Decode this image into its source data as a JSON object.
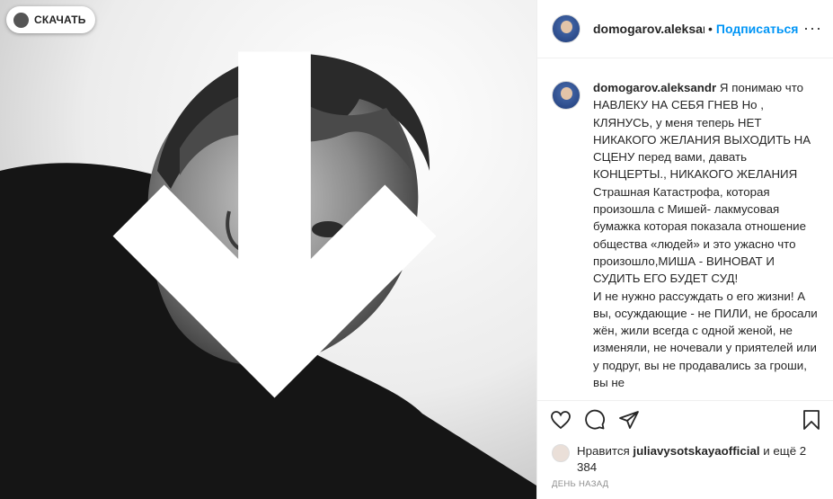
{
  "download_button": {
    "label": "СКАЧАТЬ"
  },
  "header": {
    "username": "domogarov.aleksandr",
    "separator": "•",
    "follow_label": "Подписаться",
    "more_label": "···"
  },
  "caption": {
    "username": "domogarov.aleksandr",
    "text": " Я понимаю что НАВЛЕКУ НА СЕБЯ ГНЕВ Но , КЛЯНУСЬ, у меня теперь НЕТ НИКАКОГО ЖЕЛАНИЯ ВЫХОДИТЬ НА СЦЕНУ перед вами, давать КОНЦЕРТЫ., НИКАКОГО ЖЕЛАНИЯ Страшная Катастрофа, которая произошла с Мишей- лакмусовая бумажка которая показала отношение общества «людей» и это ужасно что произошло,МИША - ВИНОВАТ И СУДИТЬ ЕГО БУДЕТ СУД!\nИ не нужно рассуждать о его жизни! А вы, осуждающие - не ПИЛИ, не бросали жён, жили всегда с одной женой, не изменяли, не ночевали у приятелей или у подруг, вы не продавались за гроши, вы не"
  },
  "actions": {
    "like_icon": "heart-icon",
    "comment_icon": "comment-icon",
    "share_icon": "share-icon",
    "save_icon": "bookmark-icon"
  },
  "likes": {
    "prefix": "Нравится ",
    "user": "juliavysotskayaofficial",
    "suffix": " и ещё 2 384"
  },
  "date": "ДЕНЬ НАЗАД",
  "colors": {
    "accent": "#0095f6",
    "text": "#262626",
    "muted": "#8e8e8e",
    "border": "#efefef"
  }
}
